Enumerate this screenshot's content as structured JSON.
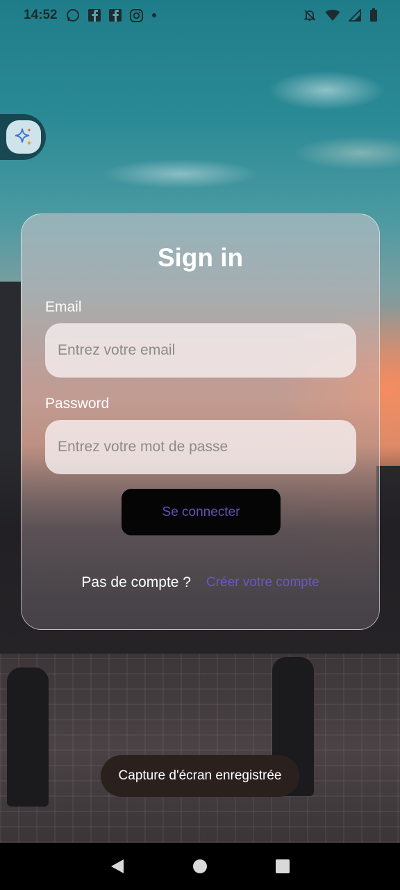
{
  "status_bar": {
    "time": "14:52",
    "left_icons": [
      "whatsapp-icon",
      "facebook-icon",
      "facebook-icon",
      "instagram-icon",
      "dot-icon"
    ],
    "right_icons": [
      "bell-off-icon",
      "wifi-icon",
      "signal-icon",
      "battery-icon"
    ]
  },
  "card": {
    "title": "Sign in",
    "email_label": "Email",
    "email_placeholder": "Entrez votre email",
    "password_label": "Password",
    "password_placeholder": "Entrez votre mot de passe",
    "login_button": "Se connecter",
    "signup_question": "Pas de compte ?",
    "signup_link": "Créer votre compte"
  },
  "toast": {
    "message": "Capture d'écran enregistrée"
  },
  "nav_bar": {
    "buttons": [
      "back-icon",
      "home-icon",
      "recents-icon"
    ]
  },
  "colors": {
    "login_button_bg": "#050506",
    "login_button_text": "#6a4fb8",
    "link": "#6c55c9",
    "toast_bg": "#2a211f"
  }
}
